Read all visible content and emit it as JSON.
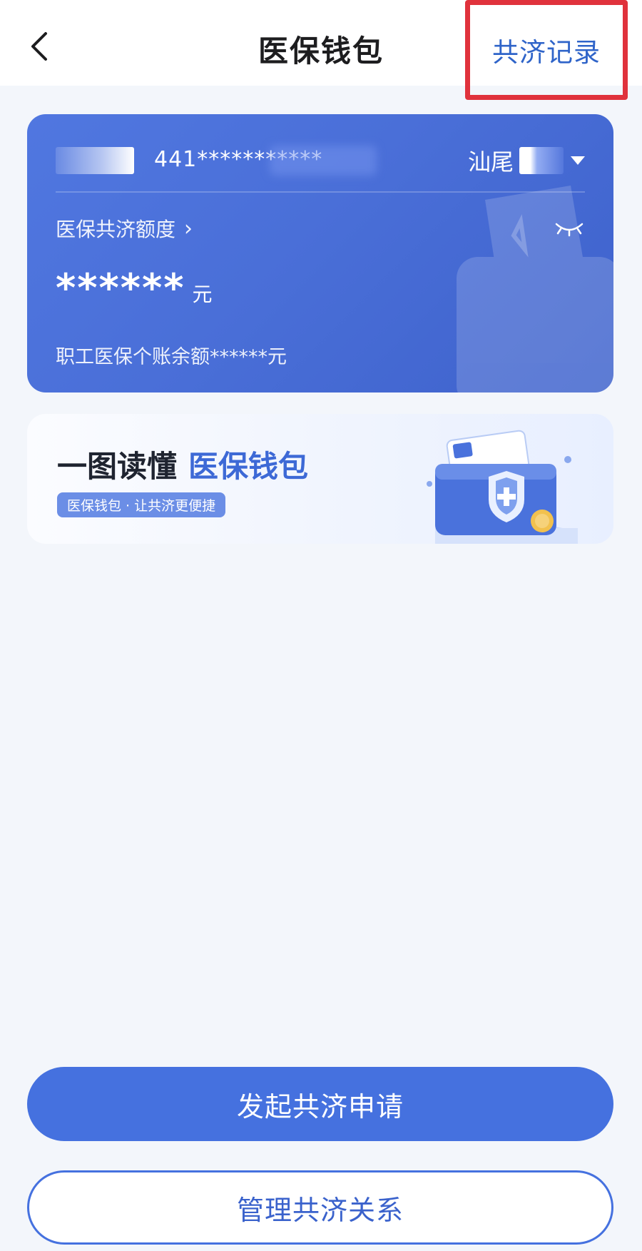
{
  "header": {
    "title": "医保钱包",
    "right_link": "共济记录"
  },
  "card": {
    "id_number": "441***********",
    "region": "汕尾",
    "quota_label": "医保共济额度",
    "amount": "******",
    "amount_unit": "元",
    "balance_text": "职工医保个账余额******元"
  },
  "banner": {
    "title_part1": "一图读懂",
    "title_part2": "医保钱包",
    "tag": "医保钱包 · 让共济更便捷"
  },
  "buttons": {
    "primary": "发起共济申请",
    "secondary": "管理共济关系"
  }
}
